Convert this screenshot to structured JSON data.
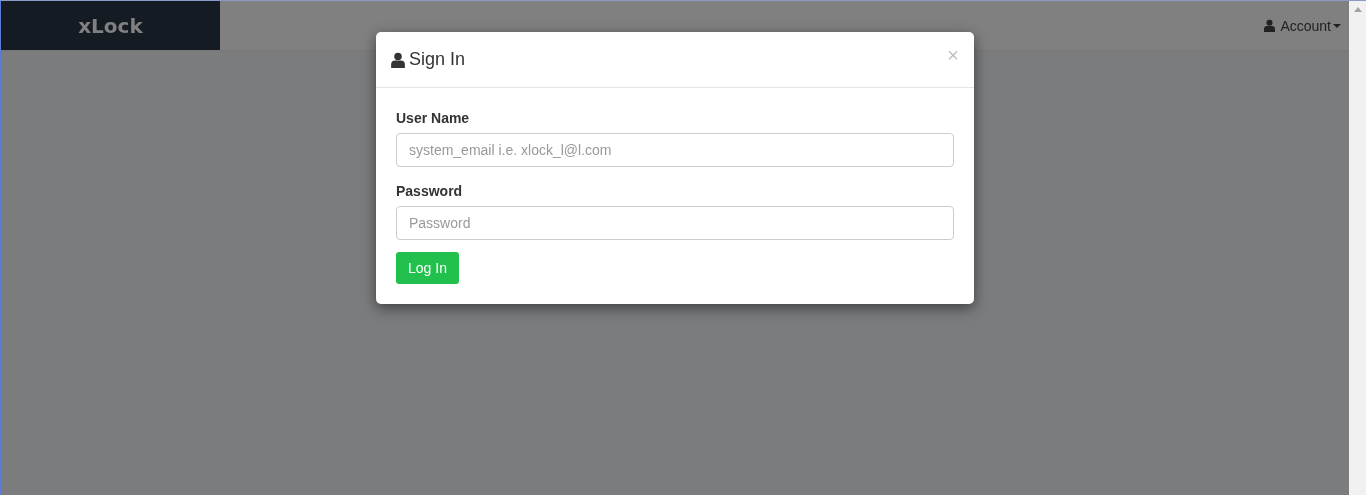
{
  "navbar": {
    "brand": "xLock",
    "account_menu": "Account"
  },
  "modal": {
    "title": "Sign In",
    "close": "×",
    "fields": [
      {
        "label": "User Name",
        "placeholder": "system_email i.e. xlock_l@l.com"
      },
      {
        "label": "Password",
        "placeholder": "Password"
      }
    ],
    "submit": "Log In"
  }
}
